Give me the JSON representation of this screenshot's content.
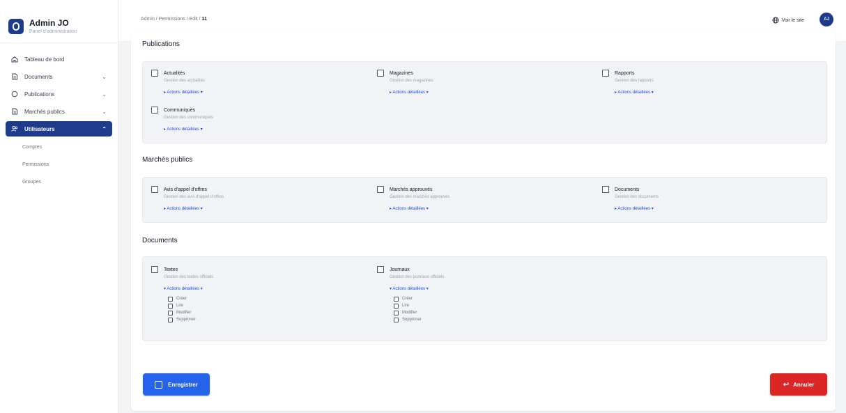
{
  "brand": {
    "title": "Admin JO",
    "subtitle": "Panel d'administration"
  },
  "sidebar": {
    "items": [
      {
        "label": "Tableau de bord",
        "icon": "home-icon",
        "chevron": ""
      },
      {
        "label": "Documents",
        "icon": "document-icon",
        "chevron": "⌄"
      },
      {
        "label": "Publications",
        "icon": "circle-icon",
        "chevron": "⌄"
      },
      {
        "label": "Marchés publics",
        "icon": "document-icon",
        "chevron": "⌄"
      },
      {
        "label": "Utilisateurs",
        "icon": "users-icon",
        "chevron": "⌃"
      }
    ],
    "subitems": [
      "Comptes",
      "Permissions",
      "Groupes"
    ]
  },
  "header": {
    "breadcrumb": "Admin / Permissions / Edit / ",
    "breadcrumb_current": "11",
    "visit_label": "Voir le site",
    "avatar": "AJ"
  },
  "sections": {
    "publications": {
      "title": "Publications",
      "items": [
        {
          "name": "Actualités",
          "desc": "Gestion des actualités",
          "actions": "▸ Actions détaillées ▾"
        },
        {
          "name": "Magazines",
          "desc": "Gestion des magazines",
          "actions": "▸ Actions détaillées ▾"
        },
        {
          "name": "Rapports",
          "desc": "Gestion des rapports",
          "actions": "▸ Actions détaillées ▾"
        },
        {
          "name": "Communiqués",
          "desc": "Gestion des communiqués",
          "actions": "▸ Actions détaillées ▾"
        }
      ]
    },
    "marches": {
      "title": "Marchés publics",
      "items": [
        {
          "name": "Avis d'appel d'offres",
          "desc": "Gestion des avis d'appel d'offres",
          "actions": "▸ Actions détaillées ▾"
        },
        {
          "name": "Marchés approuvés",
          "desc": "Gestion des marchés approuvés",
          "actions": "▸ Actions détaillées ▾"
        },
        {
          "name": "Documents",
          "desc": "Gestion des documents",
          "actions": "▸ Actions détaillées ▾"
        }
      ]
    },
    "documents": {
      "title": "Documents",
      "items": [
        {
          "name": "Textes",
          "desc": "Gestion des textes officiels",
          "actions": "▾ Actions détaillées ▾",
          "subs": [
            "Créer",
            "Lire",
            "Modifier",
            "Supprimer"
          ]
        },
        {
          "name": "Journaux",
          "desc": "Gestion des journaux officiels",
          "actions": "▾ Actions détaillées ▾",
          "subs": [
            "Créer",
            "Lire",
            "Modifier",
            "Supprimer"
          ]
        }
      ]
    }
  },
  "buttons": {
    "save": "Enregistrer",
    "cancel": "Annuler"
  },
  "colors": {
    "primary": "#1e3a8a",
    "save": "#2563eb",
    "cancel": "#dc2626"
  }
}
